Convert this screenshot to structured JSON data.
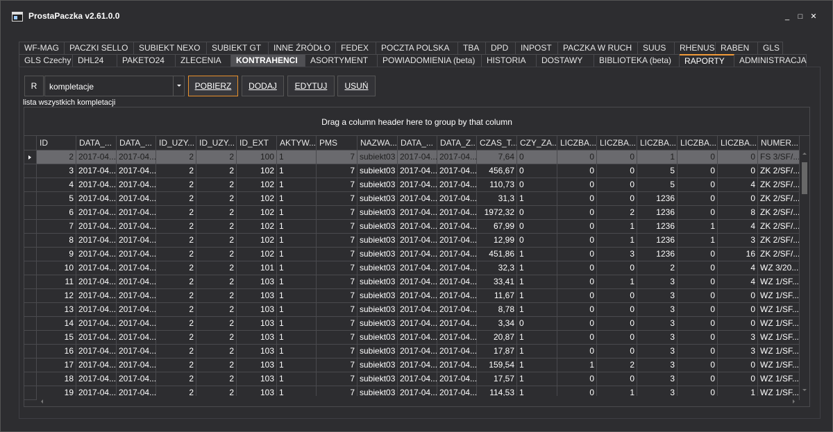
{
  "window": {
    "title": "ProstaPaczka v2.61.0.0",
    "minimize": "_",
    "maximize": "□",
    "close": "✕"
  },
  "tabs_row1": [
    {
      "label": "WF-MAG"
    },
    {
      "label": "PACZKI SELLO"
    },
    {
      "label": "SUBIEKT NEXO"
    },
    {
      "label": "SUBIEKT GT"
    },
    {
      "label": "INNE ŹRÓDŁO"
    },
    {
      "label": "FEDEX"
    },
    {
      "label": "POCZTA POLSKA"
    },
    {
      "label": "TBA"
    },
    {
      "label": "DPD"
    },
    {
      "label": "INPOST"
    },
    {
      "label": "PACZKA W RUCH"
    },
    {
      "label": "SUUS"
    },
    {
      "label": "RHENUS"
    },
    {
      "label": "RABEN"
    },
    {
      "label": "GLS"
    }
  ],
  "tabs_row2": [
    {
      "label": "GLS Czechy"
    },
    {
      "label": "DHL24"
    },
    {
      "label": "PAKETO24"
    },
    {
      "label": "ZLECENIA"
    },
    {
      "label": "KONTRAHENCI"
    },
    {
      "label": "ASORTYMENT"
    },
    {
      "label": "POWIADOMIENIA (beta)"
    },
    {
      "label": "HISTORIA"
    },
    {
      "label": "DOSTAWY"
    },
    {
      "label": "BIBLIOTEKA (beta)"
    },
    {
      "label": "RAPORTY"
    },
    {
      "label": "ADMINISTRACJA"
    }
  ],
  "toolbar": {
    "r_label": "R",
    "combo_value": "kompletacje",
    "pobierz": "POBIERZ",
    "dodaj": "DODAJ",
    "edytuj": "EDYTUJ",
    "usun": "USUŃ"
  },
  "grid": {
    "caption": "lista wszystkich kompletacji",
    "group_hint": "Drag a column header here to group by that column",
    "columns": [
      "ID",
      "DATA_...",
      "DATA_...",
      "ID_UZY...",
      "ID_UZY...",
      "ID_EXT",
      "AKTYW...",
      "PMS",
      "NAZWA...",
      "DATA_...",
      "DATA_Z...",
      "CZAS_T...",
      "CZY_ZA...",
      "LICZBA...",
      "LICZBA...",
      "LICZBA...",
      "LICZBA...",
      "LICZBA...",
      "NUMER..."
    ],
    "rows": [
      [
        "2",
        "2017-04...",
        "2017-04...",
        "2",
        "2",
        "100",
        "1",
        "7",
        "subiekt03",
        "2017-04...",
        "2017-04...",
        "7,64",
        "0",
        "0",
        "0",
        "1",
        "0",
        "0",
        "FS 3/SF/..."
      ],
      [
        "3",
        "2017-04...",
        "2017-04...",
        "2",
        "2",
        "102",
        "1",
        "7",
        "subiekt03",
        "2017-04...",
        "2017-04...",
        "456,67",
        "0",
        "0",
        "0",
        "5",
        "0",
        "0",
        "ZK 2/SF/..."
      ],
      [
        "4",
        "2017-04...",
        "2017-04...",
        "2",
        "2",
        "102",
        "1",
        "7",
        "subiekt03",
        "2017-04...",
        "2017-04...",
        "110,73",
        "0",
        "0",
        "0",
        "5",
        "0",
        "4",
        "ZK 2/SF/..."
      ],
      [
        "5",
        "2017-04...",
        "2017-04...",
        "2",
        "2",
        "102",
        "1",
        "7",
        "subiekt03",
        "2017-04...",
        "2017-04...",
        "31,3",
        "1",
        "0",
        "0",
        "1236",
        "0",
        "0",
        "ZK 2/SF/..."
      ],
      [
        "6",
        "2017-04...",
        "2017-04...",
        "2",
        "2",
        "102",
        "1",
        "7",
        "subiekt03",
        "2017-04...",
        "2017-04...",
        "1972,32",
        "0",
        "0",
        "2",
        "1236",
        "0",
        "8",
        "ZK 2/SF/..."
      ],
      [
        "7",
        "2017-04...",
        "2017-04...",
        "2",
        "2",
        "102",
        "1",
        "7",
        "subiekt03",
        "2017-04...",
        "2017-04...",
        "67,99",
        "0",
        "0",
        "1",
        "1236",
        "1",
        "4",
        "ZK 2/SF/..."
      ],
      [
        "8",
        "2017-04...",
        "2017-04...",
        "2",
        "2",
        "102",
        "1",
        "7",
        "subiekt03",
        "2017-04...",
        "2017-04...",
        "12,99",
        "0",
        "0",
        "1",
        "1236",
        "1",
        "3",
        "ZK 2/SF/..."
      ],
      [
        "9",
        "2017-04...",
        "2017-04...",
        "2",
        "2",
        "102",
        "1",
        "7",
        "subiekt03",
        "2017-04...",
        "2017-04...",
        "451,86",
        "1",
        "0",
        "3",
        "1236",
        "0",
        "16",
        "ZK 2/SF/..."
      ],
      [
        "10",
        "2017-04...",
        "2017-04...",
        "2",
        "2",
        "101",
        "1",
        "7",
        "subiekt03",
        "2017-04...",
        "2017-04...",
        "32,3",
        "1",
        "0",
        "0",
        "2",
        "0",
        "4",
        "WZ 3/20..."
      ],
      [
        "11",
        "2017-04...",
        "2017-04...",
        "2",
        "2",
        "103",
        "1",
        "7",
        "subiekt03",
        "2017-04...",
        "2017-04...",
        "33,41",
        "1",
        "0",
        "1",
        "3",
        "0",
        "4",
        "WZ 1/SF..."
      ],
      [
        "12",
        "2017-04...",
        "2017-04...",
        "2",
        "2",
        "103",
        "1",
        "7",
        "subiekt03",
        "2017-04...",
        "2017-04...",
        "11,67",
        "1",
        "0",
        "0",
        "3",
        "0",
        "0",
        "WZ 1/SF..."
      ],
      [
        "13",
        "2017-04...",
        "2017-04...",
        "2",
        "2",
        "103",
        "1",
        "7",
        "subiekt03",
        "2017-04...",
        "2017-04...",
        "8,78",
        "1",
        "0",
        "0",
        "3",
        "0",
        "0",
        "WZ 1/SF..."
      ],
      [
        "14",
        "2017-04...",
        "2017-04...",
        "2",
        "2",
        "103",
        "1",
        "7",
        "subiekt03",
        "2017-04...",
        "2017-04...",
        "3,34",
        "0",
        "0",
        "0",
        "3",
        "0",
        "0",
        "WZ 1/SF..."
      ],
      [
        "15",
        "2017-04...",
        "2017-04...",
        "2",
        "2",
        "103",
        "1",
        "7",
        "subiekt03",
        "2017-04...",
        "2017-04...",
        "20,87",
        "1",
        "0",
        "0",
        "3",
        "0",
        "3",
        "WZ 1/SF..."
      ],
      [
        "16",
        "2017-04...",
        "2017-04...",
        "2",
        "2",
        "103",
        "1",
        "7",
        "subiekt03",
        "2017-04...",
        "2017-04...",
        "17,87",
        "1",
        "0",
        "0",
        "3",
        "0",
        "3",
        "WZ 1/SF..."
      ],
      [
        "17",
        "2017-04...",
        "2017-04...",
        "2",
        "2",
        "103",
        "1",
        "7",
        "subiekt03",
        "2017-04...",
        "2017-04...",
        "159,54",
        "1",
        "1",
        "2",
        "3",
        "0",
        "0",
        "WZ 1/SF..."
      ],
      [
        "18",
        "2017-04...",
        "2017-04...",
        "2",
        "2",
        "103",
        "1",
        "7",
        "subiekt03",
        "2017-04...",
        "2017-04...",
        "17,57",
        "1",
        "0",
        "0",
        "3",
        "0",
        "0",
        "WZ 1/SF..."
      ],
      [
        "19",
        "2017-04...",
        "2017-04...",
        "2",
        "2",
        "103",
        "1",
        "7",
        "subiekt03",
        "2017-04...",
        "2017-04...",
        "114,53",
        "1",
        "0",
        "1",
        "3",
        "0",
        "1",
        "WZ 1/SF..."
      ]
    ]
  }
}
